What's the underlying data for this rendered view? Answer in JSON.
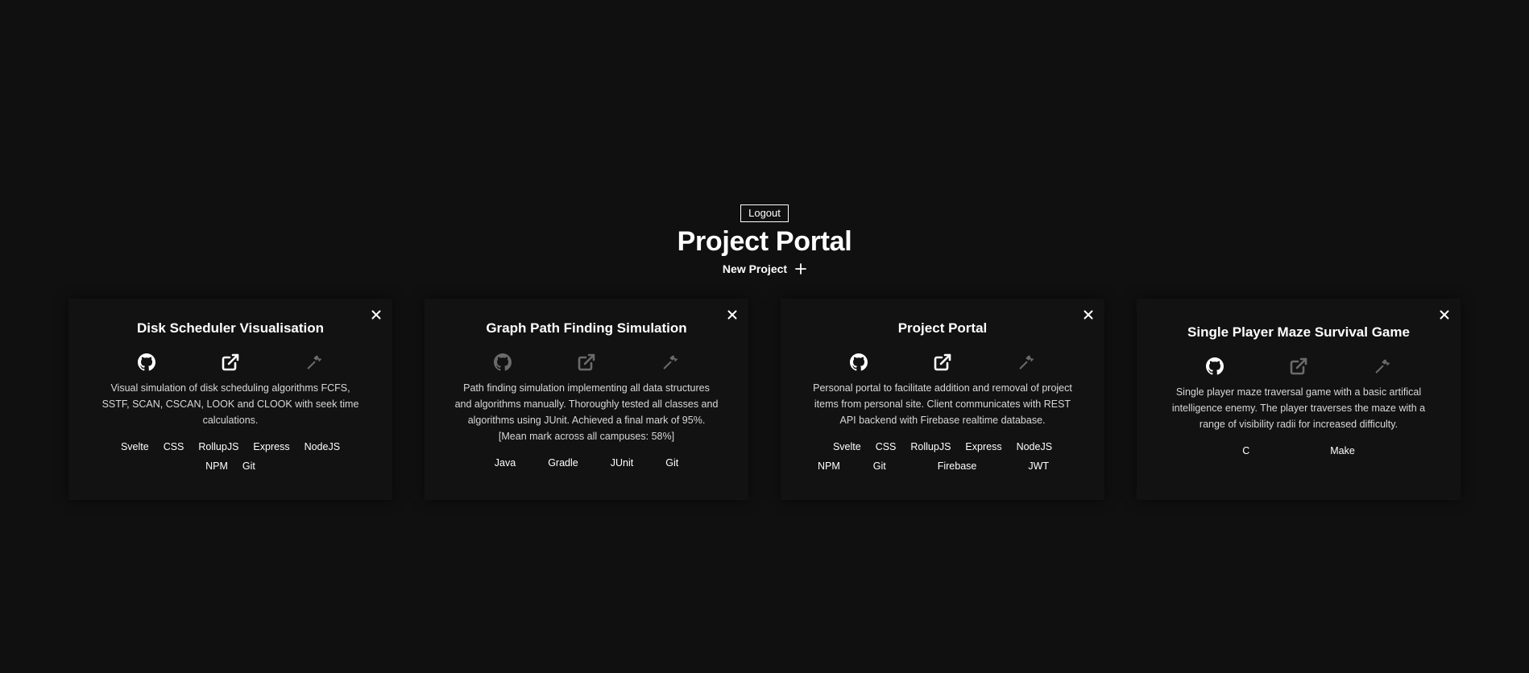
{
  "header": {
    "logout_label": "Logout",
    "title": "Project Portal",
    "new_project_label": "New Project"
  },
  "colors": {
    "background": "#101010",
    "card": "#121212",
    "text": "#ffffff",
    "muted_icon": "#6b6b6b"
  },
  "projects": [
    {
      "title": "Disk Scheduler Visualisation",
      "icons": [
        "github-icon",
        "external-link-icon",
        "hammer-icon"
      ],
      "active_icons": [
        true,
        true,
        false
      ],
      "description": "Visual simulation of disk scheduling algorithms FCFS, SSTF, SCAN, CSCAN, LOOK and CLOOK with seek time calculations.",
      "tags": [
        "Svelte",
        "CSS",
        "RollupJS",
        "Express",
        "NodeJS",
        "NPM",
        "Git"
      ]
    },
    {
      "title": "Graph Path Finding Simulation",
      "icons": [
        "github-icon",
        "external-link-icon",
        "hammer-icon"
      ],
      "active_icons": [
        false,
        false,
        false
      ],
      "description": "Path finding simulation implementing all data structures and algorithms manually. Thoroughly tested all classes and algorithms using JUnit. Achieved a final mark of 95%. [Mean mark across all campuses: 58%]",
      "tags": [
        "Java",
        "Gradle",
        "JUnit",
        "Git"
      ]
    },
    {
      "title": "Project Portal",
      "icons": [
        "github-icon",
        "external-link-icon",
        "hammer-icon"
      ],
      "active_icons": [
        true,
        true,
        false
      ],
      "description": "Personal portal to facilitate addition and removal of project items from personal site. Client communicates with REST API backend with Firebase realtime database.",
      "tags": [
        "Svelte",
        "CSS",
        "RollupJS",
        "Express",
        "NodeJS",
        "NPM",
        "Git",
        "Firebase",
        "JWT"
      ]
    },
    {
      "title": "Single Player Maze Survival Game",
      "icons": [
        "github-icon",
        "external-link-icon",
        "hammer-icon"
      ],
      "active_icons": [
        true,
        false,
        false
      ],
      "description": "Single player maze traversal game with a basic artifical intelligence enemy. The player traverses the maze with a range of visibility radii for increased difficulty.",
      "tags": [
        "C",
        "Make"
      ]
    }
  ]
}
